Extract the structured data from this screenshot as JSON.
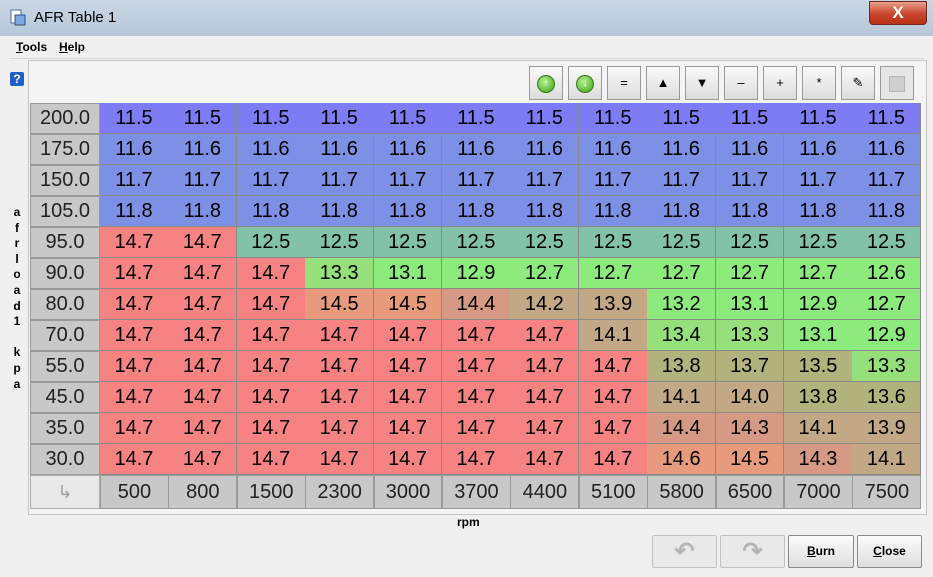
{
  "window": {
    "title": "AFR Table 1",
    "close_glyph": "X"
  },
  "menu": {
    "tools": "Tools",
    "tools_mnemonic": "T",
    "tools_rest": "ools",
    "help": "Help",
    "help_mnemonic": "H",
    "help_rest": "elp"
  },
  "help_icon_label": "?",
  "toolbar": {
    "buttons": [
      {
        "name": "rotate-up-icon",
        "kind": "round",
        "glyph": "↑"
      },
      {
        "name": "rotate-down-icon",
        "kind": "round",
        "glyph": "↓"
      },
      {
        "name": "equals-icon",
        "kind": "text",
        "glyph": "="
      },
      {
        "name": "increment-icon",
        "kind": "text",
        "glyph": "▲"
      },
      {
        "name": "decrement-icon",
        "kind": "text",
        "glyph": "▼"
      },
      {
        "name": "minus-icon",
        "kind": "text",
        "glyph": "–"
      },
      {
        "name": "plus-icon",
        "kind": "text",
        "glyph": "+"
      },
      {
        "name": "multiply-icon",
        "kind": "text",
        "glyph": "*"
      },
      {
        "name": "pen-icon",
        "kind": "text",
        "glyph": "✎"
      },
      {
        "name": "disabled-square-icon",
        "kind": "disabled",
        "glyph": ""
      }
    ]
  },
  "axis": {
    "y_label": "afrload1 kpa",
    "y_label_chars": [
      "a",
      "f",
      "r",
      "l",
      "o",
      "a",
      "d",
      "1",
      " ",
      "k",
      "p",
      "a"
    ],
    "x_label": "rpm"
  },
  "colors": {
    "blue": "#7c7cf4",
    "blue_light": "#7c90e6",
    "red": "#f78282",
    "teal": "#82c2a8",
    "green": "#8ceb7c",
    "green2": "#96e07c",
    "tan": "#d69a84",
    "salmon": "#e89a7c",
    "olive": "#b2b27c",
    "khaki": "#c2a884"
  },
  "table": {
    "rows": [
      "200.0",
      "175.0",
      "150.0",
      "105.0",
      "95.0",
      "90.0",
      "80.0",
      "70.0",
      "55.0",
      "45.0",
      "35.0",
      "30.0"
    ],
    "cols": [
      "500",
      "800",
      "1500",
      "2300",
      "3000",
      "3700",
      "4400",
      "5100",
      "5800",
      "6500",
      "7000",
      "7500"
    ],
    "values": [
      [
        "11.5",
        "11.5",
        "11.5",
        "11.5",
        "11.5",
        "11.5",
        "11.5",
        "11.5",
        "11.5",
        "11.5",
        "11.5",
        "11.5"
      ],
      [
        "11.6",
        "11.6",
        "11.6",
        "11.6",
        "11.6",
        "11.6",
        "11.6",
        "11.6",
        "11.6",
        "11.6",
        "11.6",
        "11.6"
      ],
      [
        "11.7",
        "11.7",
        "11.7",
        "11.7",
        "11.7",
        "11.7",
        "11.7",
        "11.7",
        "11.7",
        "11.7",
        "11.7",
        "11.7"
      ],
      [
        "11.8",
        "11.8",
        "11.8",
        "11.8",
        "11.8",
        "11.8",
        "11.8",
        "11.8",
        "11.8",
        "11.8",
        "11.8",
        "11.8"
      ],
      [
        "14.7",
        "14.7",
        "12.5",
        "12.5",
        "12.5",
        "12.5",
        "12.5",
        "12.5",
        "12.5",
        "12.5",
        "12.5",
        "12.5"
      ],
      [
        "14.7",
        "14.7",
        "14.7",
        "13.3",
        "13.1",
        "12.9",
        "12.7",
        "12.7",
        "12.7",
        "12.7",
        "12.7",
        "12.6"
      ],
      [
        "14.7",
        "14.7",
        "14.7",
        "14.5",
        "14.5",
        "14.4",
        "14.2",
        "13.9",
        "13.2",
        "13.1",
        "12.9",
        "12.7"
      ],
      [
        "14.7",
        "14.7",
        "14.7",
        "14.7",
        "14.7",
        "14.7",
        "14.7",
        "14.1",
        "13.4",
        "13.3",
        "13.1",
        "12.9"
      ],
      [
        "14.7",
        "14.7",
        "14.7",
        "14.7",
        "14.7",
        "14.7",
        "14.7",
        "14.7",
        "13.8",
        "13.7",
        "13.5",
        "13.3"
      ],
      [
        "14.7",
        "14.7",
        "14.7",
        "14.7",
        "14.7",
        "14.7",
        "14.7",
        "14.7",
        "14.1",
        "14.0",
        "13.8",
        "13.6"
      ],
      [
        "14.7",
        "14.7",
        "14.7",
        "14.7",
        "14.7",
        "14.7",
        "14.7",
        "14.7",
        "14.4",
        "14.3",
        "14.1",
        "13.9"
      ],
      [
        "14.7",
        "14.7",
        "14.7",
        "14.7",
        "14.7",
        "14.7",
        "14.7",
        "14.7",
        "14.6",
        "14.5",
        "14.3",
        "14.1"
      ]
    ]
  },
  "buttons": {
    "undo_glyph": "↶",
    "redo_glyph": "↷",
    "burn": "Burn",
    "burn_mnemonic": "B",
    "burn_rest": "urn",
    "close": "Close",
    "close_mnemonic": "C",
    "close_rest": "lose"
  }
}
